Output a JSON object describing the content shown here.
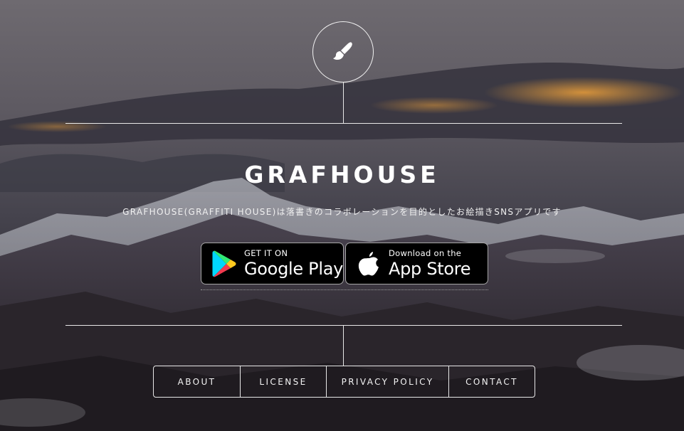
{
  "header": {
    "logo_icon": "paintbrush-icon",
    "title": "GRAFHOUSE",
    "subtitle": "GRAFHOUSE(GRAFFITI HOUSE)は落書きのコラボレーションを目的としたお絵描きSNSアプリです"
  },
  "stores": {
    "google": {
      "icon": "google-play-icon",
      "small": "GET IT ON",
      "big": "Google Play"
    },
    "apple": {
      "icon": "apple-icon",
      "small": "Download on the",
      "big": "App Store"
    }
  },
  "nav": {
    "items": [
      {
        "label": "ABOUT"
      },
      {
        "label": "LICENSE"
      },
      {
        "label": "PRIVACY POLICY"
      },
      {
        "label": "CONTACT"
      }
    ]
  },
  "colors": {
    "line": "#e8e8e8",
    "text": "#ffffff",
    "store_bg": "#000000",
    "cloud_glow": "#d9822b"
  }
}
